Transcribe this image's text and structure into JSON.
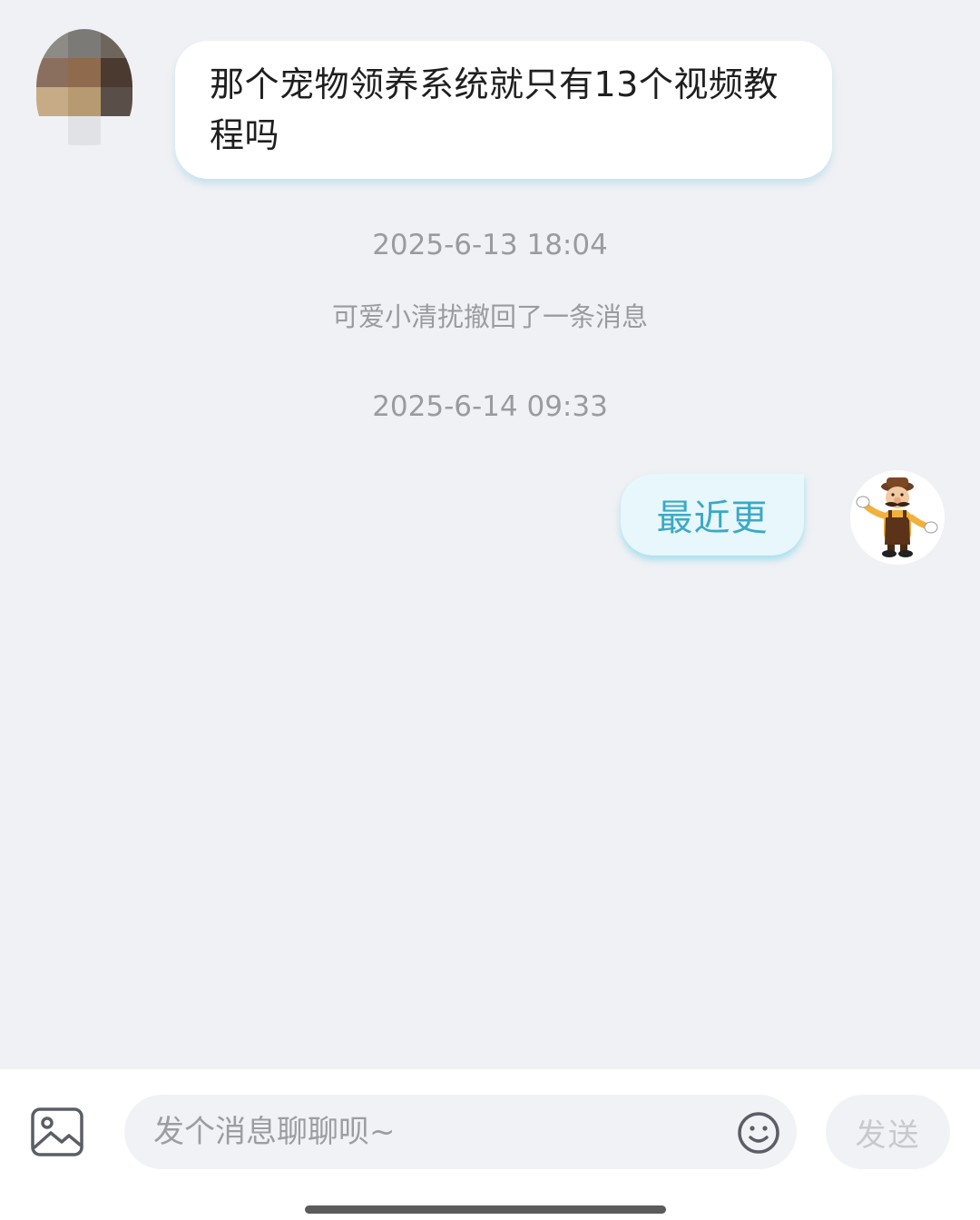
{
  "messages": {
    "incoming": {
      "text": "那个宠物领养系统就只有13个视频教程吗",
      "avatar_icon": "pixelated-user-avatar"
    },
    "timestamp_1": "2025-6-13 18:04",
    "recall_notice": "可爱小清扰撤回了一条消息",
    "timestamp_2": "2025-6-14 09:33",
    "outgoing": {
      "text": "最近更",
      "avatar_icon": "cartoon-mustache-man-avatar"
    }
  },
  "input_bar": {
    "image_icon": "image-icon",
    "placeholder": "发个消息聊聊呗~",
    "emoji_icon": "smiley-face-icon",
    "send_label": "发送"
  },
  "colors": {
    "background": "#f0f1f4",
    "incoming_bubble": "#ffffff",
    "outgoing_bubble": "#e8f7fb",
    "outgoing_text": "#3aa9c7",
    "meta_text": "#9a9b9f"
  }
}
